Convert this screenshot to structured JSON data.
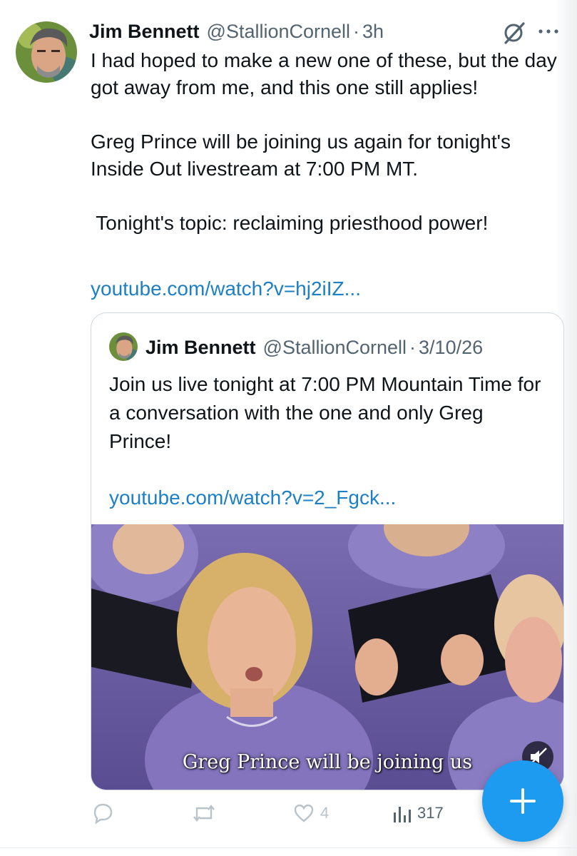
{
  "tweet": {
    "author": {
      "name": "Jim Bennett",
      "handle": "@StallionCornell",
      "time": "3h"
    },
    "text": {
      "line1": "I had hoped to make a new one of these, but the day got away from me, and this one still applies!",
      "line2": "Greg Prince will be joining us again for tonight's Inside Out livestream at 7:00 PM MT.",
      "line3": " Tonight's topic: reclaiming priesthood power!"
    },
    "link": "youtube.com/watch?v=hj2iIZ..."
  },
  "quote": {
    "author": {
      "name": "Jim Bennett",
      "handle": "@StallionCornell",
      "date": "3/10/26"
    },
    "text": "Join us live tonight at 7:00 PM Mountain Time for a conversation with the one and only Greg Prince!",
    "link": "youtube.com/watch?v=2_Fgck...",
    "video": {
      "caption": "Greg Prince will be joining us"
    }
  },
  "actions": {
    "replies": "",
    "reposts": "",
    "likes": "4",
    "views": "317"
  },
  "icons": {
    "header": [
      "grok-icon",
      "more-icon"
    ],
    "actions": [
      "reply-icon",
      "repost-icon",
      "like-icon",
      "views-icon"
    ],
    "fab": "plus-icon"
  },
  "colors": {
    "link": "#1d7fc4",
    "fab": "#1d9bf0",
    "secondary_text": "#536471"
  }
}
